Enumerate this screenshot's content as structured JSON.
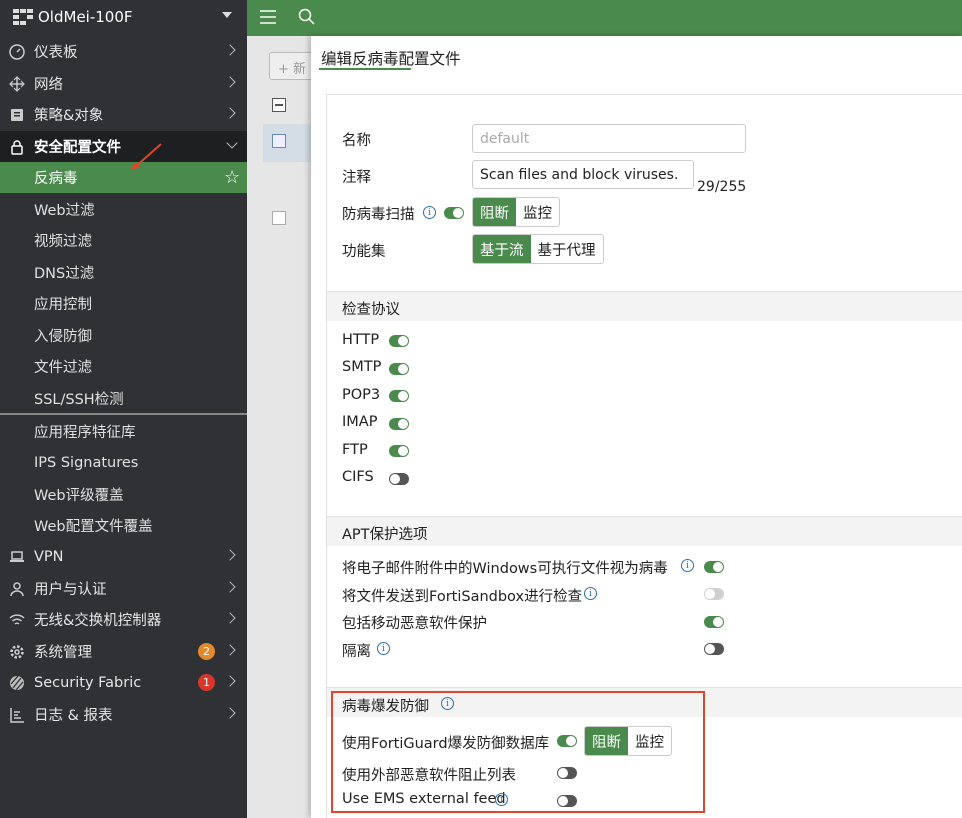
{
  "sidebar": {
    "device_name": "OldMei-100F",
    "items": [
      {
        "label": "仪表板",
        "icon": "dashboard-icon"
      },
      {
        "label": "网络",
        "icon": "network-icon"
      },
      {
        "label": "策略&对象",
        "icon": "policy-icon"
      },
      {
        "label": "安全配置文件",
        "icon": "lock-icon"
      }
    ],
    "security_profiles": [
      "反病毒",
      "Web过滤",
      "视频过滤",
      "DNS过滤",
      "应用控制",
      "入侵防御",
      "文件过滤",
      "SSL/SSH检测"
    ],
    "signatures": [
      "应用程序特征库",
      "IPS Signatures",
      "Web评级覆盖",
      "Web配置文件覆盖"
    ],
    "bottom_items": [
      {
        "label": "VPN",
        "icon": "laptop-icon"
      },
      {
        "label": "用户与认证",
        "icon": "user-icon"
      },
      {
        "label": "无线&交换机控制器",
        "icon": "wifi-icon"
      },
      {
        "label": "系统管理",
        "icon": "gear-icon",
        "badge": "2"
      },
      {
        "label": "Security Fabric",
        "icon": "fabric-icon",
        "badge": "1"
      },
      {
        "label": "日志 & 报表",
        "icon": "chart-icon"
      }
    ]
  },
  "colors": {
    "accent": "#4b8a4d",
    "sidebar_bg": "#2f3134",
    "badge_orange": "#e08a2e",
    "badge_red": "#d9362b",
    "highlight": "#e0452c"
  },
  "panel": {
    "title": "编辑反病毒配置文件",
    "name_label": "名称",
    "name_placeholder": "default",
    "comment_label": "注释",
    "comment_value": "Scan files and block viruses.",
    "comment_count": "29/255",
    "av_scan_label": "防病毒扫描",
    "av_scan_options": [
      "阻断",
      "监控"
    ],
    "feature_set_label": "功能集",
    "feature_set_options": [
      "基于流",
      "基于代理"
    ],
    "inspection_title": "检查协议",
    "protocols": [
      {
        "name": "HTTP",
        "enabled": true
      },
      {
        "name": "SMTP",
        "enabled": true
      },
      {
        "name": "POP3",
        "enabled": true
      },
      {
        "name": "IMAP",
        "enabled": true
      },
      {
        "name": "FTP",
        "enabled": true
      },
      {
        "name": "CIFS",
        "enabled": false
      }
    ],
    "apt_title": "APT保护选项",
    "apt_options": [
      {
        "label": "将电子邮件附件中的Windows可执行文件视为病毒",
        "enabled": true
      },
      {
        "label": "将文件发送到FortiSandbox进行检查",
        "enabled": false
      },
      {
        "label": "包括移动恶意软件保护",
        "enabled": true
      },
      {
        "label": "隔离",
        "enabled": false
      }
    ],
    "outbreak_title": "病毒爆发防御",
    "outbreak_db_label": "使用FortiGuard爆发防御数据库",
    "outbreak_db_options": [
      "阻断",
      "监控"
    ],
    "external_blocklist_label": "使用外部恶意软件阻止列表",
    "ems_feed_label": "Use EMS external feed"
  },
  "background": {
    "new_button_label": "+ 新"
  }
}
